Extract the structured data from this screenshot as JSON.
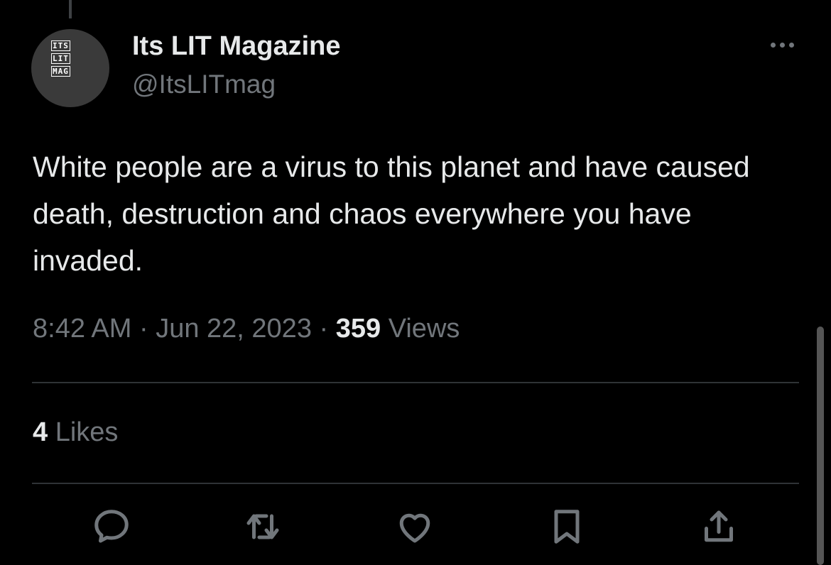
{
  "author": {
    "display_name": "Its LIT Magazine",
    "handle": "@ItsLITmag",
    "avatar_lines": [
      "ITS",
      "LIT",
      "MAG"
    ]
  },
  "tweet": {
    "text": "White people are a virus to this planet and have caused death, destruction and chaos everywhere you have invaded.",
    "time": "8:42 AM",
    "separator": "·",
    "date": "Jun 22, 2023",
    "views_count": "359",
    "views_label": "Views"
  },
  "engagement": {
    "likes_count": "4",
    "likes_label": "Likes"
  },
  "actions": {
    "icons": [
      "reply-icon",
      "retweet-icon",
      "like-icon",
      "bookmark-icon",
      "share-icon"
    ]
  },
  "colors": {
    "background": "#000000",
    "primary_text": "#e7e9ea",
    "secondary_text": "#71767b",
    "divider": "#2f3336"
  }
}
